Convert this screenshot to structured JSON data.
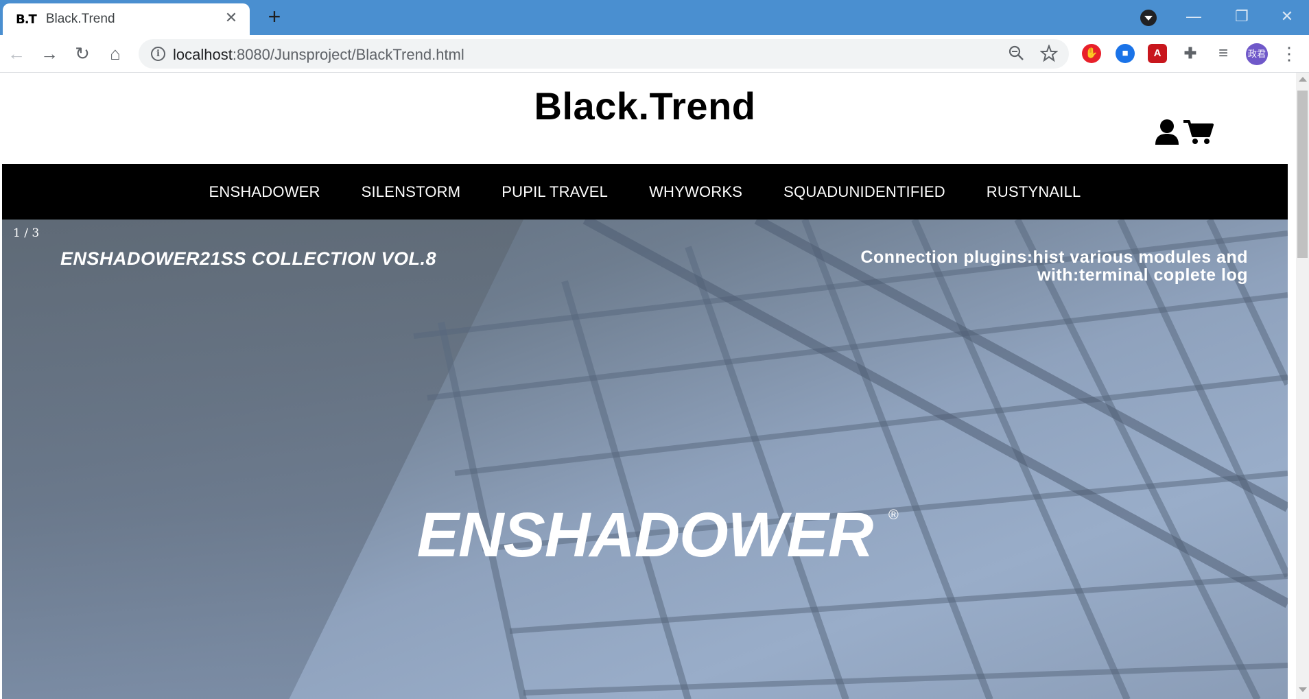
{
  "browser": {
    "tab": {
      "favicon_text": "B.T",
      "title": "Black.Trend",
      "close_glyph": "✕"
    },
    "new_tab_glyph": "+",
    "window": {
      "minimize": "—",
      "restore": "❐",
      "close": "✕"
    },
    "nav": {
      "back": "←",
      "forward": "→",
      "reload": "↻",
      "home": "⌂"
    },
    "address": {
      "host": "localhost",
      "rest": ":8080/Junsproject/BlackTrend.html",
      "info_glyph": "i"
    },
    "omnibox_icons": {
      "zoom": "zoom-out-icon",
      "bookmark": "star-icon"
    },
    "extensions": [
      {
        "name": "adblock-icon",
        "glyph": "✋",
        "color": "#e8202a"
      },
      {
        "name": "bookmark-ext-icon",
        "glyph": "■",
        "color": "#1a73e8"
      },
      {
        "name": "pdf-icon",
        "glyph": "A",
        "color": "#c8161d"
      },
      {
        "name": "puzzle-icon",
        "glyph": "✚",
        "color": "#5f6368"
      },
      {
        "name": "playlist-icon",
        "glyph": "≡",
        "color": "#5f6368"
      }
    ],
    "avatar_text": "政君",
    "menu_glyph": "⋮",
    "accent_color": "#4a8fd0"
  },
  "site": {
    "logo": "Black.Trend",
    "icons": {
      "user": "user-icon",
      "cart": "cart-icon"
    },
    "nav_items": [
      "ENSHADOWER",
      "SILENSTORM",
      "PUPIL TRAVEL",
      "WHYWORKS",
      "SQUADUNIDENTIFIED",
      "RUSTYNAILL"
    ],
    "hero": {
      "counter": "1 / 3",
      "subtitle": "ENSHADOWER21SS COLLECTION VOL.8",
      "tagline_line1": "Connection plugins:hist various modules and",
      "tagline_line2": "with:terminal coplete log",
      "brand": "ENSHADOWER",
      "registered": "®"
    }
  }
}
